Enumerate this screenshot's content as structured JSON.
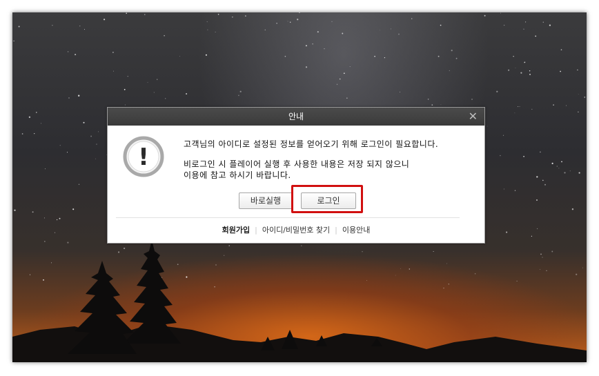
{
  "dialog": {
    "title": "안내",
    "close_glyph": "✕",
    "message_line1": "고객님의 아이디로 설정된 정보를 얻어오기 위해 로그인이 필요합니다.",
    "message_line2": "비로그인 시 플레이어 실행 후 사용한 내용은 저장 되지 않으니",
    "message_line3": "이용에 참고 하시기 바랍니다.",
    "warning_glyph": "!",
    "buttons": {
      "run_now": "바로실행",
      "login": "로그인"
    },
    "links": {
      "signup": "회원가입",
      "find_account": "아이디/비밀번호 찾기",
      "guide": "이용안내"
    },
    "icons": {
      "warning": "exclamation-circle-icon",
      "close": "close-icon"
    },
    "colors": {
      "titlebar": "#3f3f3f",
      "highlight": "#d10f0f"
    }
  }
}
